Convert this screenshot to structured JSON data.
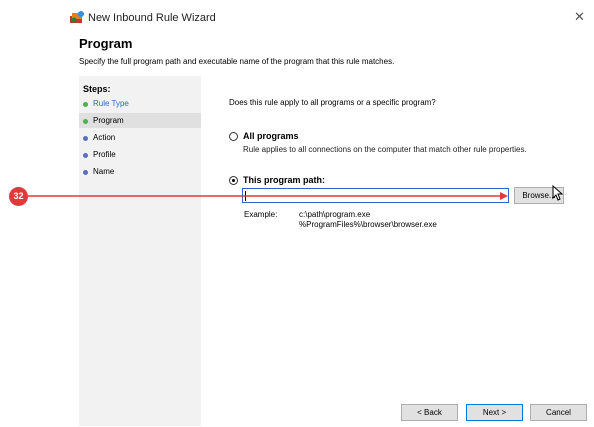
{
  "window": {
    "title": "New Inbound Rule Wizard",
    "close_glyph": "✕"
  },
  "header": {
    "heading": "Program",
    "description": "Specify the full program path and executable name of the program that this rule matches."
  },
  "steps": {
    "title": "Steps:",
    "items": [
      {
        "label": "Rule Type",
        "status": "done",
        "color": "#4caf50"
      },
      {
        "label": "Program",
        "status": "current",
        "color": "#4caf50"
      },
      {
        "label": "Action",
        "status": "pending",
        "color": "#5a6fc0"
      },
      {
        "label": "Profile",
        "status": "pending",
        "color": "#5a6fc0"
      },
      {
        "label": "Name",
        "status": "pending",
        "color": "#5a6fc0"
      }
    ]
  },
  "main": {
    "question": "Does this rule apply to all programs or a specific program?",
    "all_programs": {
      "label": "All programs",
      "desc": "Rule applies to all connections on the computer that match other rule properties.",
      "selected": false
    },
    "this_program": {
      "label": "This program path:",
      "selected": true
    },
    "path_input": {
      "value": ""
    },
    "browse_label": "Browse...",
    "example": {
      "label": "Example:",
      "line1": "c:\\path\\program.exe",
      "line2": "%ProgramFiles%\\browser\\browser.exe"
    }
  },
  "footer": {
    "back_label": "< Back",
    "next_label": "Next >",
    "cancel_label": "Cancel"
  },
  "annotation": {
    "marker": "32",
    "color": "#e03a3a"
  }
}
